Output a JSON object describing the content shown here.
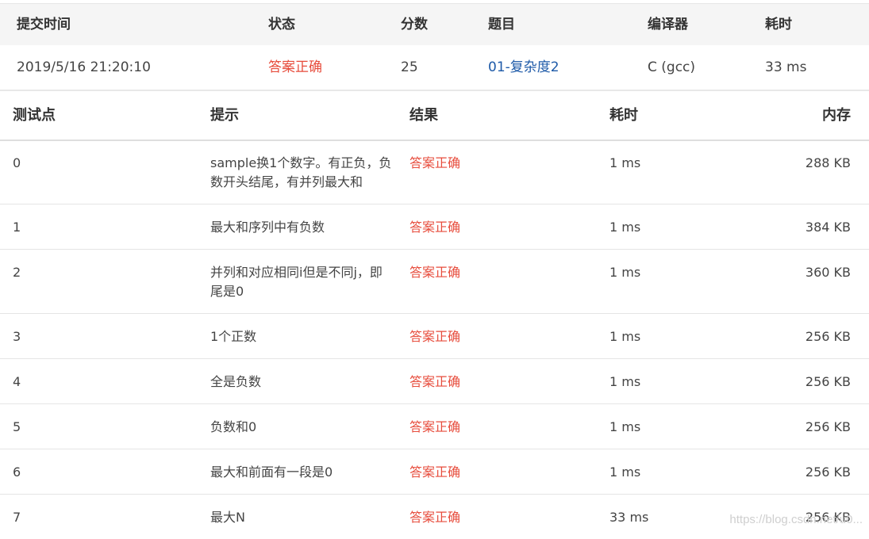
{
  "submission": {
    "headers": [
      "提交时间",
      "状态",
      "分数",
      "题目",
      "编译器",
      "耗时"
    ],
    "time": "2019/5/16 21:20:10",
    "status": "答案正确",
    "score": "25",
    "problem": "01-复杂度2",
    "compiler": "C (gcc)",
    "elapsed": "33 ms"
  },
  "cases": {
    "headers": [
      "测试点",
      "提示",
      "结果",
      "耗时",
      "内存"
    ],
    "rows": [
      {
        "id": "0",
        "hint": "sample换1个数字。有正负，负数开头结尾，有并列最大和",
        "result": "答案正确",
        "time": "1 ms",
        "memory": "288 KB"
      },
      {
        "id": "1",
        "hint": "最大和序列中有负数",
        "result": "答案正确",
        "time": "1 ms",
        "memory": "384 KB"
      },
      {
        "id": "2",
        "hint": "并列和对应相同i但是不同j，即尾是0",
        "result": "答案正确",
        "time": "1 ms",
        "memory": "360 KB"
      },
      {
        "id": "3",
        "hint": "1个正数",
        "result": "答案正确",
        "time": "1 ms",
        "memory": "256 KB"
      },
      {
        "id": "4",
        "hint": "全是负数",
        "result": "答案正确",
        "time": "1 ms",
        "memory": "256 KB"
      },
      {
        "id": "5",
        "hint": "负数和0",
        "result": "答案正确",
        "time": "1 ms",
        "memory": "256 KB"
      },
      {
        "id": "6",
        "hint": "最大和前面有一段是0",
        "result": "答案正确",
        "time": "1 ms",
        "memory": "256 KB"
      },
      {
        "id": "7",
        "hint": "最大N",
        "result": "答案正确",
        "time": "33 ms",
        "memory": "256 KB"
      }
    ]
  },
  "watermark": "https://blog.csdn.net/u0...",
  "colors": {
    "accepted": "#e74c3c",
    "link": "#1e5aa8"
  }
}
